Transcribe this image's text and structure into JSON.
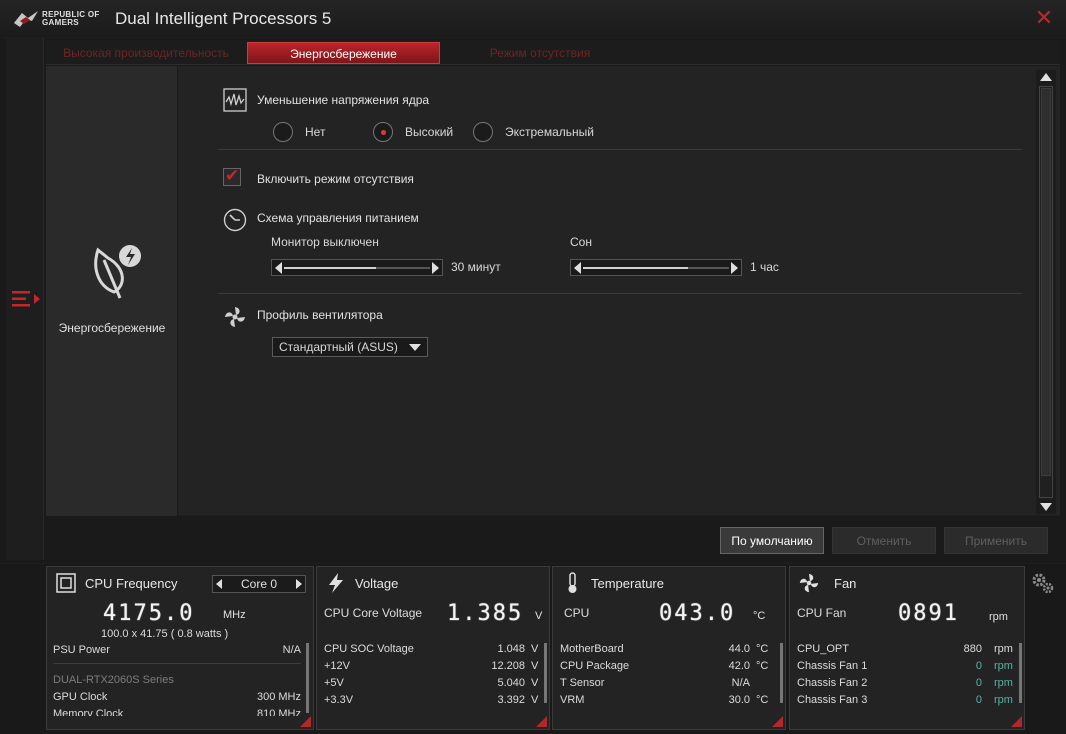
{
  "window": {
    "brand_line1": "REPUBLIC OF",
    "brand_line2": "GAMERS",
    "title": "Dual Intelligent Processors 5",
    "close": "✕"
  },
  "tabs": [
    {
      "label": "Высокая производительность",
      "active": false
    },
    {
      "label": "Энергосбережение",
      "active": true
    },
    {
      "label": "Режим отсутствия",
      "active": false
    }
  ],
  "side": {
    "label": "Энергосбережение"
  },
  "voltage": {
    "title": "Уменьшение напряжения ядра",
    "options": [
      {
        "label": "Нет",
        "checked": false
      },
      {
        "label": "Высокий",
        "checked": true
      },
      {
        "label": "Экстремальный",
        "checked": false
      }
    ]
  },
  "away": {
    "label": "Включить режим отсутствия",
    "checked": true
  },
  "power": {
    "title": "Схема управления питанием",
    "monitor": {
      "label": "Монитор выключен",
      "value": "30 минут",
      "fill": 0.63
    },
    "sleep": {
      "label": "Сон",
      "value": "1 час",
      "fill": 0.72
    }
  },
  "fan_profile": {
    "title": "Профиль вентилятора",
    "selected": "Стандартный (ASUS)"
  },
  "buttons": {
    "default": "По умолчанию",
    "cancel": "Отменить",
    "apply": "Применить"
  },
  "cpu": {
    "title": "CPU Frequency",
    "core": "Core 0",
    "freq": "4175.0",
    "freq_unit": "MHz",
    "detail": "100.0  x  41.75 ( 0.8   watts )",
    "psu_label": "PSU Power",
    "psu_value": "N/A",
    "gpu_series": "DUAL-RTX2060S Series",
    "gpu_clock_label": "GPU Clock",
    "gpu_clock_value": "300 MHz",
    "mem_clock_label": "Memory Clock",
    "mem_clock_value": "810 MHz"
  },
  "voltage_card": {
    "title": "Voltage",
    "main_label": "CPU Core Voltage",
    "main_value": "1.385",
    "main_unit": "V",
    "rows": [
      {
        "label": "CPU SOC Voltage",
        "value": "1.048",
        "unit": "V"
      },
      {
        "label": "+12V",
        "value": "12.208",
        "unit": "V"
      },
      {
        "label": "+5V",
        "value": "5.040",
        "unit": "V"
      },
      {
        "label": "+3.3V",
        "value": "3.392",
        "unit": "V"
      }
    ]
  },
  "temp_card": {
    "title": "Temperature",
    "main_label": "CPU",
    "main_value": "043.0",
    "main_unit": "°C",
    "rows": [
      {
        "label": "MotherBoard",
        "value": "44.0",
        "unit": "°C"
      },
      {
        "label": "CPU Package",
        "value": "42.0",
        "unit": "°C"
      },
      {
        "label": "T Sensor",
        "value": "N/A",
        "unit": ""
      },
      {
        "label": "VRM",
        "value": "30.0",
        "unit": "°C"
      }
    ]
  },
  "fan_card": {
    "title": "Fan",
    "main_label": "CPU Fan",
    "main_value": "0891",
    "main_unit": "rpm",
    "rows": [
      {
        "label": "CPU_OPT",
        "value": "880",
        "unit": "rpm"
      },
      {
        "label": "Chassis Fan 1",
        "value": "0",
        "unit": "rpm"
      },
      {
        "label": "Chassis Fan 2",
        "value": "0",
        "unit": "rpm"
      },
      {
        "label": "Chassis Fan 3",
        "value": "0",
        "unit": "rpm"
      }
    ]
  },
  "colors": {
    "accent": "#c3272b",
    "background": "#1a1a1a",
    "panel": "#232323",
    "teal": "#55b3a4"
  }
}
